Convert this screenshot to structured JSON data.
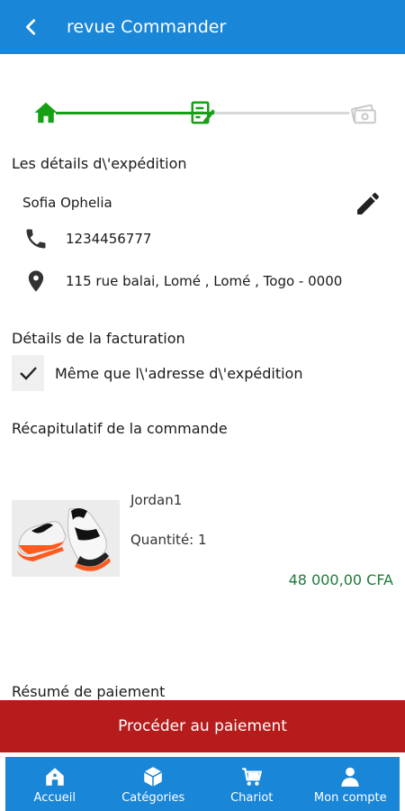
{
  "header": {
    "title": "revue Commander",
    "back_icon": "arrow-back-icon"
  },
  "stepper": {
    "steps": [
      "home-icon",
      "edit-note-icon",
      "money-icon"
    ],
    "active_color": "#16a016",
    "inactive_color": "#d8d8d8",
    "current_step": 2
  },
  "shipping": {
    "title": "Les détails d\\'expédition",
    "name": "Sofia Ophelia",
    "phone": "1234456777",
    "address": "115 rue balai, Lomé , Lomé , Togo - 0000",
    "edit_icon": "pencil-icon"
  },
  "billing": {
    "title": "Détails de la facturation",
    "same_as_label": "Même que l\\'adresse d\\'expédition",
    "same_as_checked": true
  },
  "order_summary": {
    "title": "Récapitulatif de la commande",
    "items": [
      {
        "name": "Jordan1",
        "quantity_label": "Quantité:",
        "quantity": "1",
        "price": "48 000,00 CFA"
      }
    ]
  },
  "payment_summary": {
    "title": "Résumé de paiement"
  },
  "cta": {
    "label": "Procéder au paiement",
    "color": "#b71c1c"
  },
  "bottom_nav": {
    "items": [
      {
        "label": "Accueil",
        "icon": "home-icon"
      },
      {
        "label": "Catégories",
        "icon": "box-icon"
      },
      {
        "label": "Chariot",
        "icon": "cart-icon"
      },
      {
        "label": "Mon compte",
        "icon": "user-icon"
      }
    ]
  },
  "colors": {
    "primary": "#1a86d8",
    "price": "#1f7a3a"
  }
}
